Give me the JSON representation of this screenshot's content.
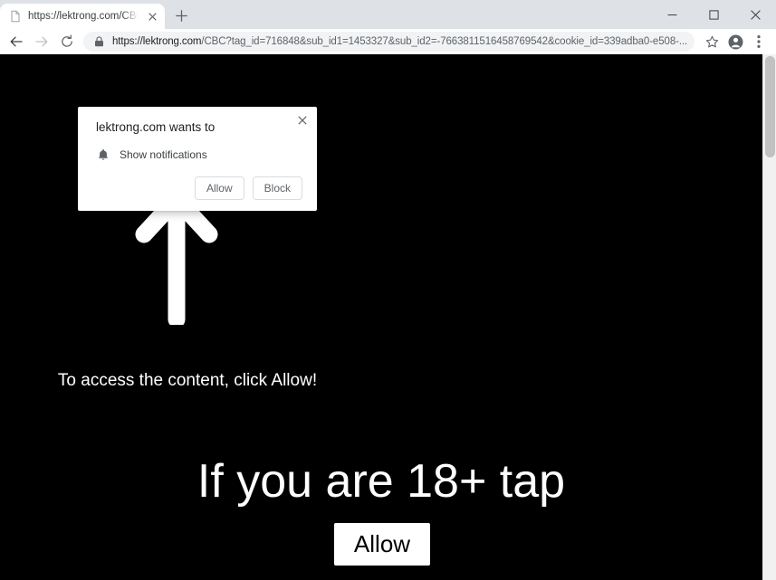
{
  "window": {
    "controls": [
      {
        "name": "minimize",
        "glyph": "minimize-icon"
      },
      {
        "name": "maximize",
        "glyph": "maximize-icon"
      },
      {
        "name": "close",
        "glyph": "close-icon"
      }
    ]
  },
  "tab_strip": {
    "tabs": [
      {
        "title": "https://lektrong.com/CBC?tag_id",
        "favicon": "page-icon",
        "active": true
      }
    ],
    "new_tab_tooltip": "New tab"
  },
  "toolbar": {
    "back": "back-icon",
    "forward": "forward-icon",
    "reload": "reload-icon",
    "security_icon": "lock-icon",
    "url_host": "https://lektrong.com",
    "url_path": "/CBC?tag_id=716848&sub_id1=1453327&sub_id2=-7663811516458769542&cookie_id=339adba0-e508-...",
    "url_full": "https://lektrong.com/CBC?tag_id=716848&sub_id1=1453327&sub_id2=-7663811516458769542&cookie_id=339adba0-e508-...",
    "bookmark": "star-icon",
    "profile": "profile-avatar-icon",
    "menu": "three-dot-menu-icon"
  },
  "permission_bubble": {
    "title": "lektrong.com wants to",
    "permission_icon": "bell-icon",
    "permission_label": "Show notifications",
    "allow_label": "Allow",
    "block_label": "Block",
    "close_label": "close-icon"
  },
  "page": {
    "background_color": "#000000",
    "text_color": "#ffffff",
    "arrow_icon": "arrow-up-icon",
    "instruction_text": "To access the content, click Allow!",
    "headline_text": "If you are 18+ tap",
    "allow_button_label": "Allow"
  },
  "scrollbar": {
    "track_color": "#f1f1f1",
    "thumb_color": "#c1c1c1"
  }
}
